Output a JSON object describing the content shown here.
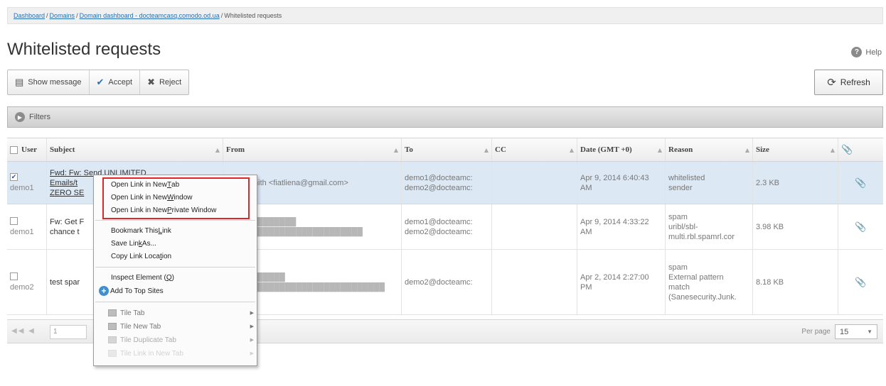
{
  "breadcrumb": {
    "items": [
      "Dashboard",
      "Domains",
      "Domain dashboard - docteamcasq.comodo.od.ua"
    ],
    "current": "Whitelisted requests",
    "separator": "/"
  },
  "page": {
    "title": "Whitelisted requests"
  },
  "help": {
    "label": "Help",
    "icon": "?"
  },
  "toolbar": {
    "show_message": "Show message",
    "accept": "Accept",
    "reject": "Reject",
    "refresh": "Refresh"
  },
  "filters": {
    "label": "Filters"
  },
  "table": {
    "columns": [
      "User",
      "Subject",
      "From",
      "To",
      "CC",
      "Date (GMT +0)",
      "Reason",
      "Size"
    ],
    "rows": [
      {
        "user": "demo1",
        "subject_line1": "Fwd: Fw: Send UNLIMITED",
        "subject_line2": "Emails/t",
        "subject_line3": "ZERO SE",
        "from": "mith <fiatliena@gmail.com>",
        "to1": "demo1@docteamc:",
        "to2": "demo2@docteamc:",
        "cc": "",
        "date1": "Apr 9, 2014 6:40:43",
        "date2": "AM",
        "reason1": "whitelisted",
        "reason2": "sender",
        "size": "2.3 KB"
      },
      {
        "user": "demo1",
        "subject_line1": "Fw: Get F",
        "subject_line2": "chance t",
        "from": "",
        "to1": "demo1@docteamc:",
        "to2": "demo2@docteamc:",
        "cc": "",
        "date1": "Apr 9, 2014 4:33:22",
        "date2": "AM",
        "reason1": "spam",
        "reason2": "uribl/sbl-",
        "reason3": "multi.rbl.spamrl.cor",
        "size": "3.98 KB"
      },
      {
        "user": "demo2",
        "subject_line1": "test spar",
        "from": "",
        "to1": "demo2@docteamc:",
        "cc": "",
        "date1": "Apr 2, 2014 2:27:00",
        "date2": "PM",
        "reason1": "spam",
        "reason2": "External pattern",
        "reason3": "match",
        "reason4": "(Sanesecurity.Junk.",
        "size": "8.18 KB"
      }
    ]
  },
  "pager": {
    "page": "1",
    "per_page_label": "Per page",
    "per_page_value": "15"
  },
  "context_menu": {
    "open_new_tab_pre": "Open Link in New ",
    "open_new_tab_key": "T",
    "open_new_tab_post": "ab",
    "open_new_window_pre": "Open Link in New ",
    "open_new_window_key": "W",
    "open_new_window_post": "indow",
    "open_private_pre": "Open Link in New ",
    "open_private_key": "P",
    "open_private_post": "rivate Window",
    "bookmark_pre": "Bookmark This ",
    "bookmark_key": "L",
    "bookmark_post": "ink",
    "save_pre": "Save Lin",
    "save_key": "k",
    "save_post": " As...",
    "copy_pre": "Copy Link Loca",
    "copy_key": "t",
    "copy_post": "ion",
    "inspect_pre": "Inspect Element (",
    "inspect_key": "Q",
    "inspect_post": ")",
    "add_top_sites": "Add To Top Sites",
    "tile_tab": "Tile Tab",
    "tile_new_tab": "Tile New Tab",
    "tile_duplicate_tab": "Tile Duplicate Tab",
    "tile_link_new_tab": "Tile Link in New Tab"
  }
}
